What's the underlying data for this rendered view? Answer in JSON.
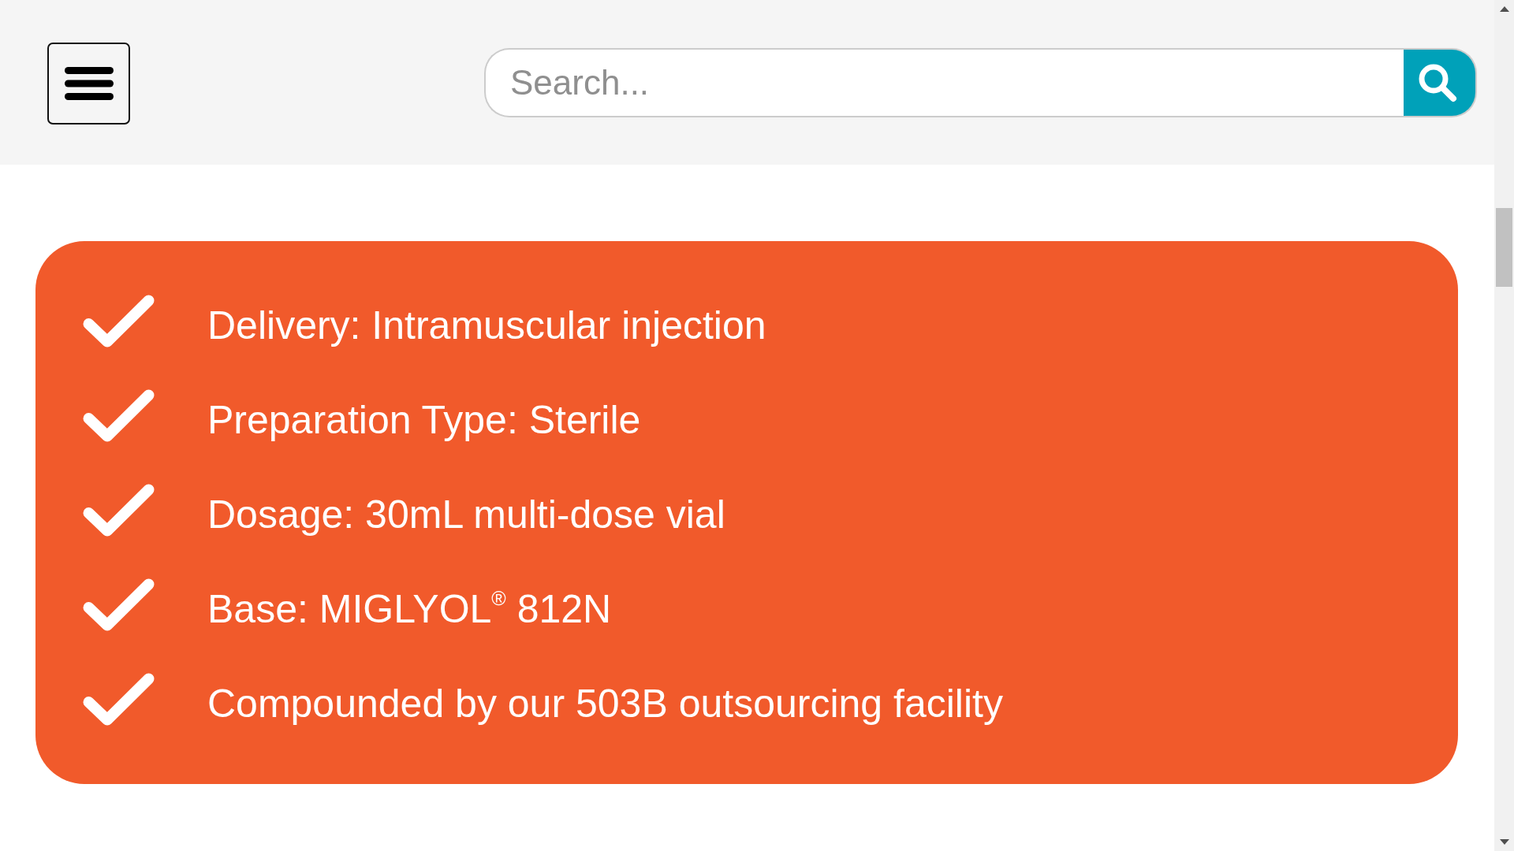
{
  "header": {
    "search": {
      "placeholder": "Search..."
    }
  },
  "features": [
    {
      "text": "Delivery: Intramuscular injection"
    },
    {
      "text": "Preparation Type: Sterile"
    },
    {
      "text": "Dosage: 30mL multi-dose vial"
    },
    {
      "text": "Base: MIGLYOL$^{®}$ 812N"
    },
    {
      "text": "Compounded by our 503B outsourcing facility"
    }
  ]
}
